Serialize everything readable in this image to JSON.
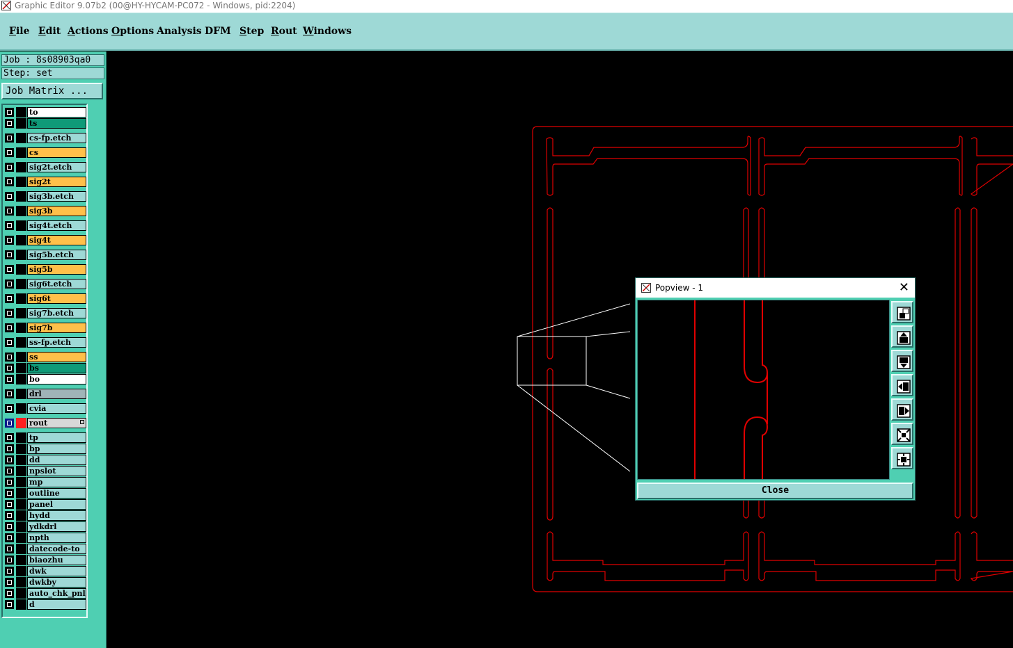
{
  "window": {
    "title": "Graphic Editor 9.07b2 (00@HY-HYCAM-PC072 - Windows, pid:2204)"
  },
  "menu": [
    {
      "label": "File",
      "u": "F",
      "rest": "ile"
    },
    {
      "label": "Edit",
      "u": "E",
      "rest": "dit"
    },
    {
      "label": "Actions",
      "u": "A",
      "rest": "ctions"
    },
    {
      "label": "Options",
      "u": "O",
      "rest": "ptions"
    },
    {
      "label": "Analysis",
      "u": "",
      "rest": "Analysis"
    },
    {
      "label": "DFM",
      "u": "",
      "rest": "DFM"
    },
    {
      "label": "Step",
      "u": "S",
      "rest": "tep"
    },
    {
      "label": "Rout",
      "u": "R",
      "rest": "out"
    },
    {
      "label": "Windows",
      "u": "W",
      "rest": "indows"
    }
  ],
  "info": {
    "job": "Job : 8s08903qa0",
    "step": "Step: set",
    "job_matrix": "Job Matrix ..."
  },
  "layers": [
    {
      "name": "to",
      "color": "#ffffff"
    },
    {
      "name": "ts",
      "color": "#0f9a78"
    },
    {
      "name": "cs-fp.etch",
      "color": "#9ed9d6"
    },
    {
      "name": "cs",
      "color": "#ffc04a"
    },
    {
      "name": "sig2t.etch",
      "color": "#9ed9d6"
    },
    {
      "name": "sig2t",
      "color": "#ffc04a"
    },
    {
      "name": "sig3b.etch",
      "color": "#9ed9d6"
    },
    {
      "name": "sig3b",
      "color": "#ffc04a"
    },
    {
      "name": "sig4t.etch",
      "color": "#9ed9d6"
    },
    {
      "name": "sig4t",
      "color": "#ffc04a"
    },
    {
      "name": "sig5b.etch",
      "color": "#9ed9d6"
    },
    {
      "name": "sig5b",
      "color": "#ffc04a"
    },
    {
      "name": "sig6t.etch",
      "color": "#9ed9d6"
    },
    {
      "name": "sig6t",
      "color": "#ffc04a"
    },
    {
      "name": "sig7b.etch",
      "color": "#9ed9d6"
    },
    {
      "name": "sig7b",
      "color": "#ffc04a"
    },
    {
      "name": "ss-fp.etch",
      "color": "#9ed9d6"
    },
    {
      "name": "ss",
      "color": "#ffc04a"
    },
    {
      "name": "bs",
      "color": "#0f9a78"
    },
    {
      "name": "bo",
      "color": "#ffffff"
    },
    {
      "name": "drl",
      "color": "#a0b4b8"
    },
    {
      "name": "cvia",
      "color": "#9ed9d6"
    },
    {
      "name": "rout",
      "color": "#d8d8d8",
      "active": true,
      "swatch": "#ff2020"
    },
    {
      "name": "tp",
      "color": "#9ed9d6"
    },
    {
      "name": "bp",
      "color": "#9ed9d6"
    },
    {
      "name": "dd",
      "color": "#9ed9d6"
    },
    {
      "name": "npslot",
      "color": "#9ed9d6"
    },
    {
      "name": "mp",
      "color": "#9ed9d6"
    },
    {
      "name": "outline",
      "color": "#9ed9d6"
    },
    {
      "name": "panel",
      "color": "#9ed9d6"
    },
    {
      "name": "hydd",
      "color": "#9ed9d6"
    },
    {
      "name": "ydkdrl",
      "color": "#9ed9d6"
    },
    {
      "name": "npth",
      "color": "#9ed9d6"
    },
    {
      "name": "datecode-to",
      "color": "#9ed9d6"
    },
    {
      "name": "biaozhu",
      "color": "#9ed9d6"
    },
    {
      "name": "dwk",
      "color": "#9ed9d6"
    },
    {
      "name": "dwkby",
      "color": "#9ed9d6"
    },
    {
      "name": "auto_chk_pnl",
      "color": "#9ed9d6"
    },
    {
      "name": "d",
      "color": "#9ed9d6"
    }
  ],
  "popview": {
    "title": "Popview - 1",
    "close_label": "Close",
    "tools": [
      "zoom-window-icon",
      "pan-up-icon",
      "pan-down-icon",
      "pan-left-icon",
      "pan-right-icon",
      "zoom-out-icon",
      "zoom-in-icon"
    ]
  },
  "colors": {
    "rout": "#e00000",
    "menubar": "#9ed9d6",
    "panel": "#4fcfb2"
  }
}
